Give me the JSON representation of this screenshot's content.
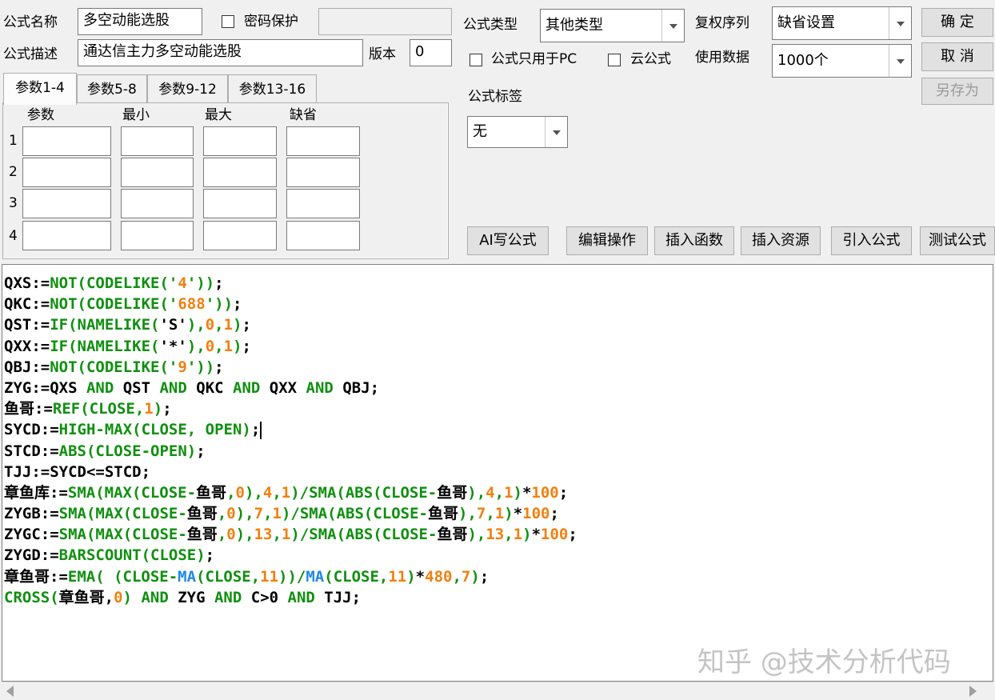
{
  "top": {
    "formula_name_label": "公式名称",
    "formula_name_value": "多空动能选股",
    "password_protect_label": "密码保护",
    "password_value": "",
    "formula_desc_label": "公式描述",
    "formula_desc_value": "通达信主力多空动能选股",
    "version_label": "版本",
    "version_value": "0",
    "formula_type_label": "公式类型",
    "formula_type_value": "其他类型",
    "rights_label": "复权序列",
    "rights_value": "缺省设置",
    "pc_only_label": "公式只用于PC",
    "cloud_label": "云公式",
    "use_data_label": "使用数据",
    "use_data_value": "1000个",
    "tag_label": "公式标签",
    "tag_value": "无"
  },
  "buttons": {
    "ok": "确 定",
    "cancel": "取 消",
    "save_as": "另存为",
    "ai": "AI写公式",
    "edit": "编辑操作",
    "insert_func": "插入函数",
    "insert_res": "插入资源",
    "import": "引入公式",
    "test": "测试公式"
  },
  "tabs": [
    "参数1-4",
    "参数5-8",
    "参数9-12",
    "参数13-16"
  ],
  "params": {
    "headers": [
      "参数",
      "最小",
      "最大",
      "缺省"
    ],
    "rows": [
      "1",
      "2",
      "3",
      "4"
    ]
  },
  "code_colors": {
    "default": "#000000",
    "keyword": "#109010",
    "number": "#f08010",
    "ma": "#1e88e5"
  },
  "code_lines": [
    [
      [
        "d",
        "QXS:="
      ],
      [
        "k",
        "NOT(CODELIKE('"
      ],
      [
        "n",
        "4"
      ],
      [
        "k",
        "'))"
      ],
      [
        "d",
        ";"
      ]
    ],
    [
      [
        "d",
        "QKC:="
      ],
      [
        "k",
        "NOT(CODELIKE('"
      ],
      [
        "n",
        "688"
      ],
      [
        "k",
        "'))"
      ],
      [
        "d",
        ";"
      ]
    ],
    [
      [
        "d",
        "QST:="
      ],
      [
        "k",
        "IF(NAMELIKE("
      ],
      [
        "d",
        "'S'"
      ],
      [
        "k",
        "),"
      ],
      [
        "n",
        "0"
      ],
      [
        "k",
        ","
      ],
      [
        "n",
        "1"
      ],
      [
        "k",
        ")"
      ],
      [
        "d",
        ";"
      ]
    ],
    [
      [
        "d",
        "QXX:="
      ],
      [
        "k",
        "IF(NAMELIKE("
      ],
      [
        "d",
        "'*'"
      ],
      [
        "k",
        "),"
      ],
      [
        "n",
        "0"
      ],
      [
        "k",
        ","
      ],
      [
        "n",
        "1"
      ],
      [
        "k",
        ")"
      ],
      [
        "d",
        ";"
      ]
    ],
    [
      [
        "d",
        "QBJ:="
      ],
      [
        "k",
        "NOT(CODELIKE('"
      ],
      [
        "n",
        "9"
      ],
      [
        "k",
        "'))"
      ],
      [
        "d",
        ";"
      ]
    ],
    [
      [
        "d",
        "ZYG:=QXS "
      ],
      [
        "k",
        "AND"
      ],
      [
        "d",
        " QST "
      ],
      [
        "k",
        "AND"
      ],
      [
        "d",
        " QKC "
      ],
      [
        "k",
        "AND"
      ],
      [
        "d",
        " QXX "
      ],
      [
        "k",
        "AND"
      ],
      [
        "d",
        " QBJ;"
      ]
    ],
    [
      [
        "d",
        "鱼哥:="
      ],
      [
        "k",
        "REF(CLOSE,"
      ],
      [
        "n",
        "1"
      ],
      [
        "k",
        ")"
      ],
      [
        "d",
        ";"
      ]
    ],
    [
      [
        "d",
        "SYCD:="
      ],
      [
        "k",
        "HIGH-MAX(CLOSE, OPEN)"
      ],
      [
        "d",
        ";"
      ]
    ],
    [
      [
        "d",
        "STCD:="
      ],
      [
        "k",
        "ABS(CLOSE-OPEN)"
      ],
      [
        "d",
        ";"
      ]
    ],
    [
      [
        "d",
        "TJJ:=SYCD<=STCD;"
      ]
    ],
    [
      [
        "d",
        "章鱼库:="
      ],
      [
        "k",
        "SMA(MAX(CLOSE-"
      ],
      [
        "d",
        "鱼哥"
      ],
      [
        "k",
        ","
      ],
      [
        "n",
        "0"
      ],
      [
        "k",
        "),"
      ],
      [
        "n",
        "4"
      ],
      [
        "k",
        ","
      ],
      [
        "n",
        "1"
      ],
      [
        "k",
        ")/SMA(ABS(CLOSE-"
      ],
      [
        "d",
        "鱼哥"
      ],
      [
        "k",
        "),"
      ],
      [
        "n",
        "4"
      ],
      [
        "k",
        ","
      ],
      [
        "n",
        "1"
      ],
      [
        "k",
        ")"
      ],
      [
        "d",
        "*"
      ],
      [
        "n",
        "100"
      ],
      [
        "d",
        ";"
      ]
    ],
    [
      [
        "d",
        "ZYGB:="
      ],
      [
        "k",
        "SMA(MAX(CLOSE-"
      ],
      [
        "d",
        "鱼哥"
      ],
      [
        "k",
        ","
      ],
      [
        "n",
        "0"
      ],
      [
        "k",
        "),"
      ],
      [
        "n",
        "7"
      ],
      [
        "k",
        ","
      ],
      [
        "n",
        "1"
      ],
      [
        "k",
        ")/SMA(ABS(CLOSE-"
      ],
      [
        "d",
        "鱼哥"
      ],
      [
        "k",
        "),"
      ],
      [
        "n",
        "7"
      ],
      [
        "k",
        ","
      ],
      [
        "n",
        "1"
      ],
      [
        "k",
        ")"
      ],
      [
        "d",
        "*"
      ],
      [
        "n",
        "100"
      ],
      [
        "d",
        ";"
      ]
    ],
    [
      [
        "d",
        "ZYGC:="
      ],
      [
        "k",
        "SMA(MAX(CLOSE-"
      ],
      [
        "d",
        "鱼哥"
      ],
      [
        "k",
        ","
      ],
      [
        "n",
        "0"
      ],
      [
        "k",
        "),"
      ],
      [
        "n",
        "13"
      ],
      [
        "k",
        ","
      ],
      [
        "n",
        "1"
      ],
      [
        "k",
        ")/SMA(ABS(CLOSE-"
      ],
      [
        "d",
        "鱼哥"
      ],
      [
        "k",
        "),"
      ],
      [
        "n",
        "13"
      ],
      [
        "k",
        ","
      ],
      [
        "n",
        "1"
      ],
      [
        "k",
        ")"
      ],
      [
        "d",
        "*"
      ],
      [
        "n",
        "100"
      ],
      [
        "d",
        ";"
      ]
    ],
    [
      [
        "d",
        "ZYGD:="
      ],
      [
        "k",
        "BARSCOUNT(CLOSE)"
      ],
      [
        "d",
        ";"
      ]
    ],
    [
      [
        "d",
        "章鱼哥:="
      ],
      [
        "k",
        "EMA( (CLOSE-"
      ],
      [
        "m",
        "MA"
      ],
      [
        "k",
        "(CLOSE,"
      ],
      [
        "n",
        "11"
      ],
      [
        "k",
        "))/"
      ],
      [
        "m",
        "MA"
      ],
      [
        "k",
        "(CLOSE,"
      ],
      [
        "n",
        "11"
      ],
      [
        "k",
        ")"
      ],
      [
        "d",
        "*"
      ],
      [
        "n",
        "480"
      ],
      [
        "k",
        ","
      ],
      [
        "n",
        "7"
      ],
      [
        "k",
        ")"
      ],
      [
        "d",
        ";"
      ]
    ],
    [
      [
        "k",
        "CROSS("
      ],
      [
        "d",
        "章鱼哥,"
      ],
      [
        "n",
        "0"
      ],
      [
        "k",
        ")"
      ],
      [
        "d",
        " "
      ],
      [
        "k",
        "AND"
      ],
      [
        "d",
        " ZYG "
      ],
      [
        "k",
        "AND"
      ],
      [
        "d",
        " C>0 "
      ],
      [
        "k",
        "AND"
      ],
      [
        "d",
        " TJJ;"
      ]
    ]
  ],
  "watermark": "知乎 @技术分析代码"
}
